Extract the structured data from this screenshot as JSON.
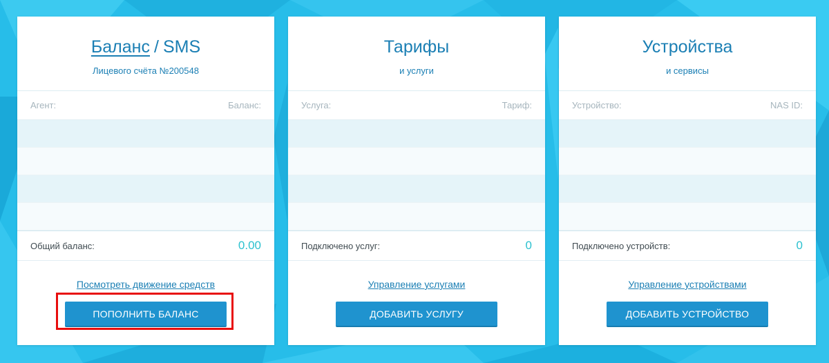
{
  "colors": {
    "background": "#27bde9",
    "card": "#ffffff",
    "title": "#1b7fb4",
    "accent_value": "#2cc1cf",
    "button": "#1f93cf",
    "highlight": "#e80d0d"
  },
  "cards": [
    {
      "title_link": "Баланс",
      "title_sep": "/",
      "title_rest": "SMS",
      "subtitle": "Лицевого счёта №200548",
      "col_left": "Агент:",
      "col_right": "Баланс:",
      "total_label": "Общий баланс:",
      "total_value": "0.00",
      "link": "Посмотреть движение средств",
      "button": "Пополнить баланс"
    },
    {
      "title": "Тарифы",
      "subtitle": "и услуги",
      "col_left": "Услуга:",
      "col_right": "Тариф:",
      "total_label": "Подключено услуг:",
      "total_value": "0",
      "link": "Управление услугами",
      "button": "Добавить услугу"
    },
    {
      "title": "Устройства",
      "subtitle": "и сервисы",
      "col_left": "Устройство:",
      "col_right": "NAS ID:",
      "total_label": "Подключено устройств:",
      "total_value": "0",
      "link": "Управление устройствами",
      "button": "Добавить устройство"
    }
  ]
}
